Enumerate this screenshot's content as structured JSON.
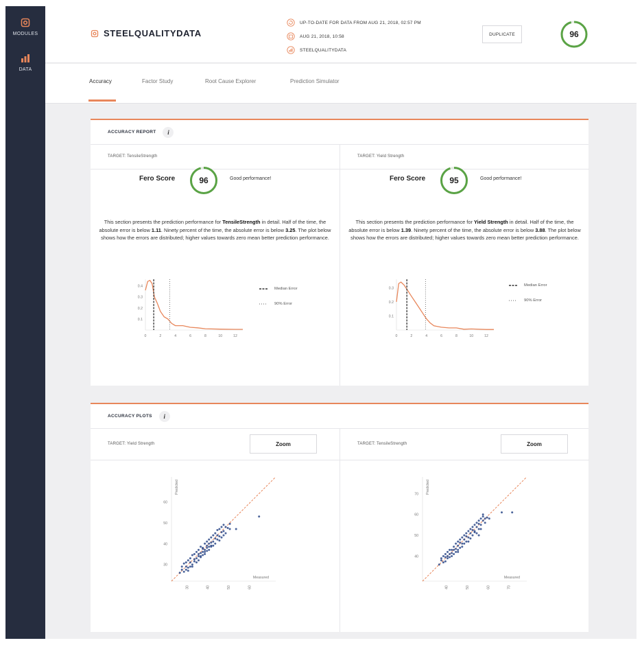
{
  "sidebar": {
    "items": [
      {
        "label": "MODULES",
        "icon": "gear-icon",
        "color": "#e8865a"
      },
      {
        "label": "DATA",
        "icon": "bar-chart-icon",
        "color": "#e8865a"
      }
    ]
  },
  "header": {
    "title": "STEELQUALITYDATA",
    "meta": [
      {
        "icon": "refresh-icon",
        "text": "UP-TO-DATE FOR DATA FROM AUG 21, 2018, 02:57 PM"
      },
      {
        "icon": "calendar-icon",
        "text": "AUG 21, 2018, 10:58"
      },
      {
        "icon": "chart-icon",
        "text": "STEELQUALITYDATA"
      }
    ],
    "duplicate_label": "DUPLICATE",
    "score": "96"
  },
  "tabs": [
    "Accuracy",
    "Factor Study",
    "Root Cause Explorer",
    "Prediction Simulator"
  ],
  "accuracy_report": {
    "title": "ACCURACY REPORT",
    "info": "i",
    "columns": [
      {
        "target": "TARGET: TensileStrength",
        "fero_label": "Fero Score",
        "score": "96",
        "performance": "Good performance!",
        "desc": {
          "p1": "This section presents the prediction performance for ",
          "target_name": "TensileStrength",
          "p2": " in detail. Half of the time, the absolute error is below ",
          "median": "1.11",
          "p3": ". Ninety percent of the time, the absolute error is below ",
          "p90": "3.25",
          "p4": ". The plot below shows how the errors are distributed; higher values towards zero mean better prediction performance."
        },
        "legend": {
          "median": "Median Error",
          "p90": "90% Error"
        }
      },
      {
        "target": "TARGET: Yield Strength",
        "fero_label": "Fero Score",
        "score": "95",
        "performance": "Good performance!",
        "desc": {
          "p1": "This section presents the prediction performance for ",
          "target_name": "Yield Strength",
          "p2": " in detail. Half of the time, the absolute error is below ",
          "median": "1.39",
          "p3": ". Ninety percent of the time, the absolute error is below ",
          "p90": "3.88",
          "p4": ". The plot below shows how the errors are distributed; higher values towards zero mean better prediction performance."
        },
        "legend": {
          "median": "Median Error",
          "p90": "90% Error"
        }
      }
    ]
  },
  "accuracy_plots": {
    "title": "ACCURACY PLOTS",
    "info": "i",
    "columns": [
      {
        "target": "TARGET: Yield Strength",
        "zoom": "Zoom"
      },
      {
        "target": "TARGET: TensileStrength",
        "zoom": "Zoom"
      }
    ]
  },
  "colors": {
    "accent": "#e8865a",
    "good": "#5aa345",
    "point": "#2e4a8a",
    "sidebar": "#262d3f"
  },
  "chart_data": [
    {
      "type": "area",
      "x": [
        0,
        0.3,
        0.6,
        0.9,
        1.2,
        1.6,
        2.0,
        2.5,
        3.0,
        3.5,
        4.0,
        5.0,
        6.0,
        7.0,
        8.0,
        10.0,
        12.0,
        13.0
      ],
      "y": [
        0.36,
        0.44,
        0.45,
        0.42,
        0.3,
        0.24,
        0.17,
        0.12,
        0.1,
        0.06,
        0.04,
        0.04,
        0.025,
        0.02,
        0.012,
        0.008,
        0.006,
        0.006
      ],
      "yticks": [
        "0.1",
        "0.2",
        "0.3",
        "0.4"
      ],
      "xticks": [
        "0",
        "2",
        "4",
        "6",
        "8",
        "10",
        "12"
      ],
      "median": 1.11,
      "p90": 3.25,
      "xlim": [
        0,
        13
      ],
      "ylim": [
        0,
        0.46
      ]
    },
    {
      "type": "area",
      "x": [
        0,
        0.3,
        0.6,
        1.0,
        1.5,
        2.0,
        2.5,
        3.0,
        3.5,
        4.0,
        4.5,
        5.0,
        6.0,
        7.0,
        8.0,
        9.0,
        10.0,
        12.0,
        13.0
      ],
      "y": [
        0.2,
        0.33,
        0.34,
        0.32,
        0.28,
        0.24,
        0.2,
        0.16,
        0.12,
        0.08,
        0.05,
        0.03,
        0.02,
        0.015,
        0.015,
        0.006,
        0.008,
        0.004,
        0.004
      ],
      "yticks": [
        "0.1",
        "0.2",
        "0.3"
      ],
      "xticks": [
        "0",
        "2",
        "4",
        "6",
        "8",
        "10",
        "12"
      ],
      "median": 1.39,
      "p90": 3.88,
      "xlim": [
        0,
        13
      ],
      "ylim": [
        0,
        0.36
      ]
    },
    {
      "type": "scatter",
      "xlabel": "Measured",
      "ylabel": "Predicted",
      "yticks": [
        "30",
        "40",
        "50",
        "60"
      ],
      "xticks": [
        "30",
        "40",
        "50",
        "60"
      ],
      "xlim": [
        22,
        72
      ],
      "ylim": [
        22,
        72
      ],
      "points": [
        [
          26,
          26
        ],
        [
          27,
          27.5
        ],
        [
          28,
          26.5
        ],
        [
          29,
          29
        ],
        [
          30,
          28.5
        ],
        [
          31,
          31
        ],
        [
          32,
          30
        ],
        [
          33,
          32.5
        ],
        [
          34,
          33
        ],
        [
          35,
          34
        ],
        [
          36,
          35.5
        ],
        [
          37,
          36
        ],
        [
          38,
          37
        ],
        [
          39,
          39
        ],
        [
          40,
          38.5
        ],
        [
          41,
          40.5
        ],
        [
          42,
          41
        ],
        [
          43,
          42.5
        ],
        [
          44,
          44
        ],
        [
          45,
          43.5
        ],
        [
          46,
          45.5
        ],
        [
          47,
          46
        ],
        [
          48,
          48
        ],
        [
          49,
          47.5
        ],
        [
          50,
          49.5
        ],
        [
          29,
          31
        ],
        [
          31,
          29
        ],
        [
          33,
          35
        ],
        [
          35,
          32
        ],
        [
          37,
          38
        ],
        [
          39,
          36.5
        ],
        [
          41,
          43
        ],
        [
          43,
          40
        ],
        [
          45,
          47
        ],
        [
          47,
          44
        ],
        [
          28,
          30.5
        ],
        [
          30,
          32
        ],
        [
          32,
          29
        ],
        [
          34,
          36
        ],
        [
          36,
          33.5
        ],
        [
          38,
          40
        ],
        [
          40,
          37
        ],
        [
          42,
          44
        ],
        [
          44,
          42
        ],
        [
          46,
          48
        ],
        [
          48,
          45
        ],
        [
          30,
          27
        ],
        [
          34,
          31
        ],
        [
          38,
          35
        ],
        [
          42,
          39
        ],
        [
          46,
          43
        ],
        [
          50,
          47
        ],
        [
          27,
          29
        ],
        [
          31,
          33
        ],
        [
          35,
          37
        ],
        [
          39,
          41
        ],
        [
          43,
          45
        ],
        [
          47,
          49
        ],
        [
          32,
          34.5
        ],
        [
          36,
          38.5
        ],
        [
          40,
          42
        ],
        [
          44,
          46.5
        ],
        [
          29,
          27.5
        ],
        [
          33,
          31.5
        ],
        [
          37,
          34.5
        ],
        [
          41,
          38.5
        ],
        [
          45,
          41.5
        ],
        [
          35,
          35
        ],
        [
          36,
          34
        ],
        [
          37,
          37.5
        ],
        [
          38,
          36
        ],
        [
          39,
          38
        ],
        [
          40,
          40
        ],
        [
          41,
          39
        ],
        [
          53,
          47
        ],
        [
          64,
          53
        ]
      ]
    },
    {
      "type": "scatter",
      "xlabel": "Measured",
      "ylabel": "Predicted",
      "yticks": [
        "40",
        "50",
        "60",
        "70"
      ],
      "xticks": [
        "40",
        "50",
        "60",
        "70"
      ],
      "xlim": [
        28,
        78
      ],
      "ylim": [
        28,
        78
      ],
      "points": [
        [
          36,
          36
        ],
        [
          37,
          38
        ],
        [
          38,
          37
        ],
        [
          39,
          39.5
        ],
        [
          40,
          39
        ],
        [
          41,
          41
        ],
        [
          42,
          41.5
        ],
        [
          43,
          43
        ],
        [
          44,
          43.5
        ],
        [
          45,
          45
        ],
        [
          46,
          46.5
        ],
        [
          47,
          46
        ],
        [
          48,
          48
        ],
        [
          49,
          49.5
        ],
        [
          50,
          49
        ],
        [
          51,
          51
        ],
        [
          52,
          52.5
        ],
        [
          53,
          52
        ],
        [
          54,
          54
        ],
        [
          55,
          55.5
        ],
        [
          56,
          55
        ],
        [
          57,
          57
        ],
        [
          58,
          58
        ],
        [
          38,
          40
        ],
        [
          40,
          42
        ],
        [
          42,
          40
        ],
        [
          44,
          46
        ],
        [
          46,
          44
        ],
        [
          48,
          50
        ],
        [
          50,
          47
        ],
        [
          52,
          54
        ],
        [
          54,
          51
        ],
        [
          56,
          58
        ],
        [
          39,
          37.5
        ],
        [
          41,
          43
        ],
        [
          43,
          41
        ],
        [
          45,
          47
        ],
        [
          47,
          44.5
        ],
        [
          49,
          51
        ],
        [
          51,
          48.5
        ],
        [
          53,
          55
        ],
        [
          55,
          53
        ],
        [
          57,
          59
        ],
        [
          40,
          40
        ],
        [
          42,
          43
        ],
        [
          44,
          42
        ],
        [
          46,
          48
        ],
        [
          48,
          46
        ],
        [
          50,
          52
        ],
        [
          52,
          50
        ],
        [
          54,
          56
        ],
        [
          56,
          53
        ],
        [
          41,
          39.5
        ],
        [
          43,
          44.5
        ],
        [
          45,
          43
        ],
        [
          47,
          49
        ],
        [
          49,
          47
        ],
        [
          51,
          53
        ],
        [
          53,
          51.5
        ],
        [
          55,
          57
        ],
        [
          37,
          39
        ],
        [
          39,
          41
        ],
        [
          45,
          42
        ],
        [
          58,
          56
        ],
        [
          57,
          60
        ],
        [
          59,
          58.5
        ],
        [
          60,
          58
        ],
        [
          55,
          50
        ],
        [
          66,
          61
        ],
        [
          71,
          61
        ]
      ]
    }
  ]
}
